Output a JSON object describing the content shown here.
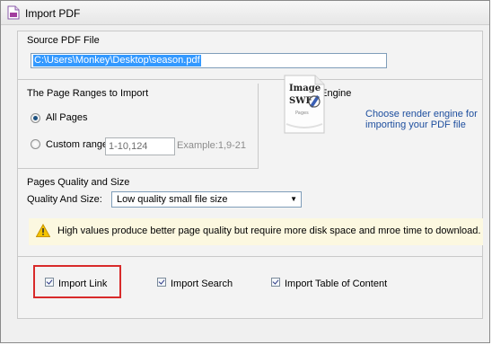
{
  "window": {
    "title": "Import PDF",
    "title_icon": "pdf-icon"
  },
  "source": {
    "group_label": "Source PDF File",
    "path_value": "C:\\Users\\Monkey\\Desktop\\season.pdf"
  },
  "page_ranges": {
    "group_label": "The Page Ranges to Import",
    "all_pages_label": "All Pages",
    "all_pages_selected": true,
    "custom_label": "Custom range:",
    "custom_value": "1-10,124",
    "example": "Example:1,9-21"
  },
  "render_engine": {
    "group_label": "Render Engine",
    "image_line1": "Image",
    "image_line2": "SWF",
    "image_line3": "Pages",
    "description_line1": "Choose render engine for",
    "description_line2": "importing your PDF file"
  },
  "quality": {
    "group_label": "Pages Quality and Size",
    "field_label": "Quality And Size:",
    "selected": "Low quality small file size"
  },
  "warning": {
    "icon": "warning-icon",
    "text": "High values produce better page quality but require more disk space and mroe time to download."
  },
  "options": {
    "import_link": {
      "label": "Import Link",
      "checked": true
    },
    "import_search": {
      "label": "Import Search",
      "checked": true
    },
    "import_toc": {
      "label": "Import Table of Content",
      "checked": true
    }
  },
  "colors": {
    "highlight": "#d82a2a",
    "selection": "#3399ff",
    "link_text": "#1d4e9e"
  }
}
